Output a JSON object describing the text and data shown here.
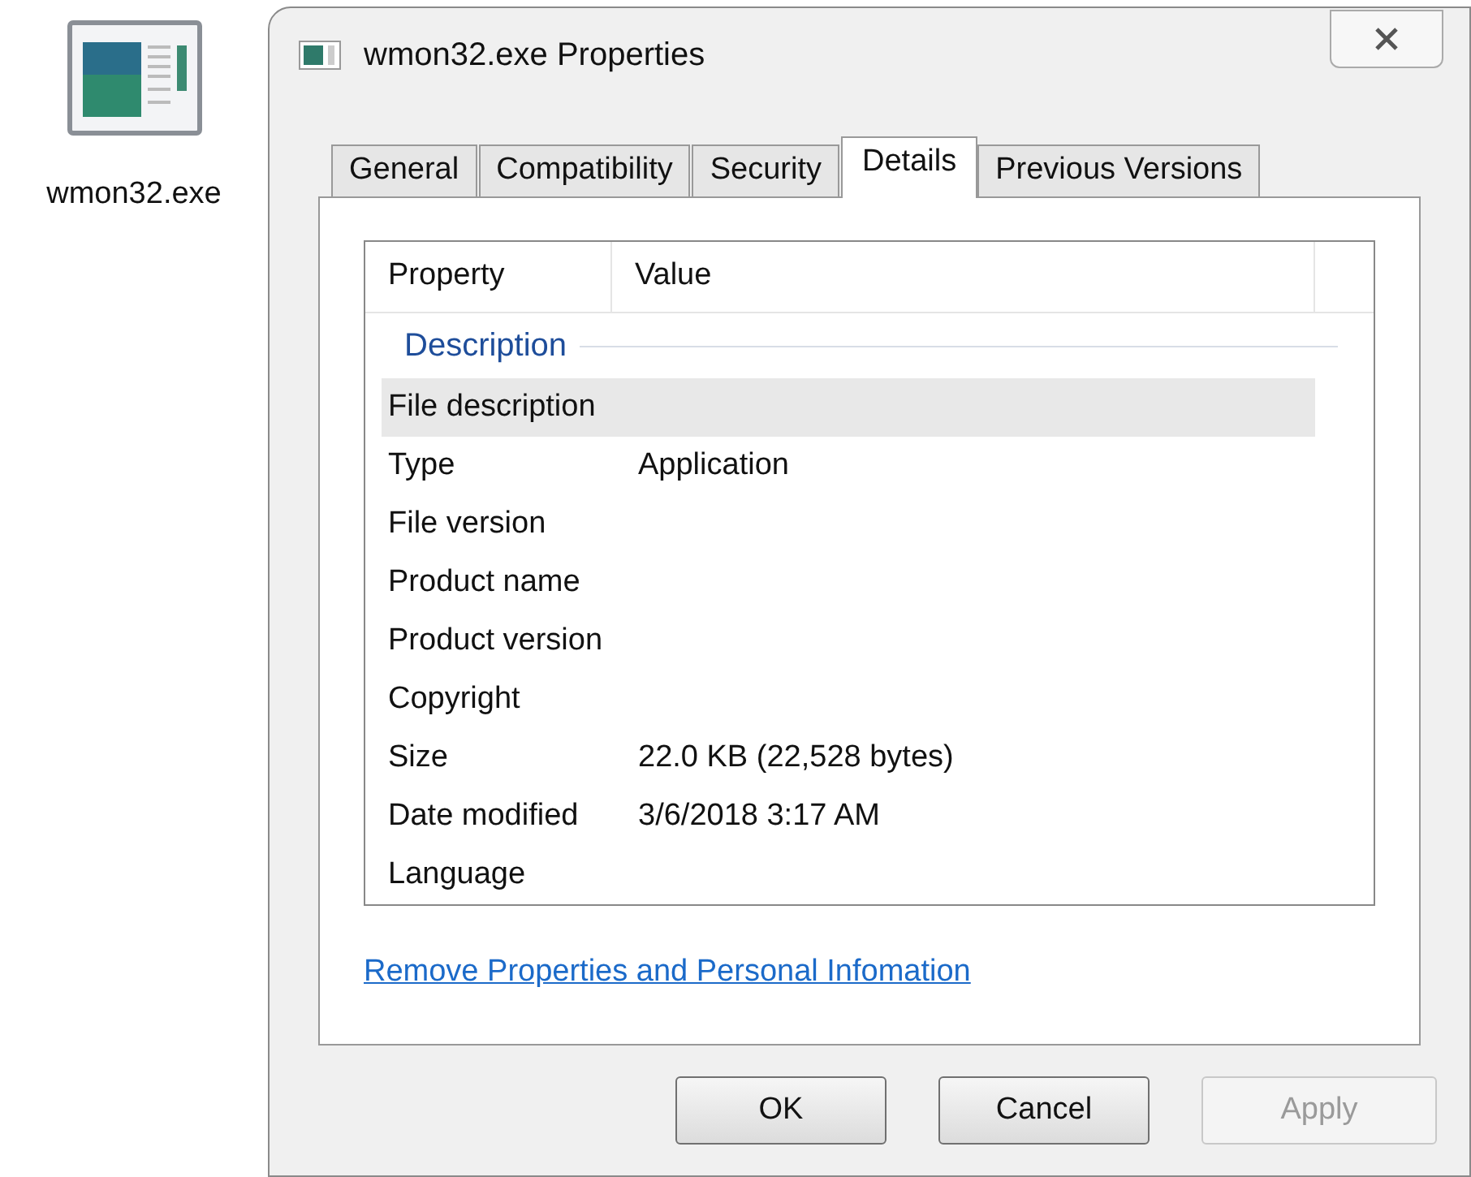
{
  "desktop_icon": {
    "label": "wmon32.exe"
  },
  "window": {
    "title": "wmon32.exe Properties"
  },
  "tabs": [
    {
      "label": "General",
      "selected": false
    },
    {
      "label": "Compatibility",
      "selected": false
    },
    {
      "label": "Security",
      "selected": false
    },
    {
      "label": "Details",
      "selected": true
    },
    {
      "label": "Previous Versions",
      "selected": false
    }
  ],
  "table": {
    "columns": [
      "Property",
      "Value"
    ],
    "rows": [
      {
        "kind": "group",
        "label": "Description"
      },
      {
        "kind": "item",
        "property": "File description",
        "value": "",
        "selected": true
      },
      {
        "kind": "item",
        "property": "Type",
        "value": "Application",
        "selected": false
      },
      {
        "kind": "item",
        "property": "File version",
        "value": "",
        "selected": false
      },
      {
        "kind": "item",
        "property": "Product name",
        "value": "",
        "selected": false
      },
      {
        "kind": "item",
        "property": "Product version",
        "value": "",
        "selected": false
      },
      {
        "kind": "item",
        "property": "Copyright",
        "value": "",
        "selected": false
      },
      {
        "kind": "item",
        "property": "Size",
        "value": "22.0 KB (22,528 bytes)",
        "selected": false
      },
      {
        "kind": "item",
        "property": "Date modified",
        "value": "3/6/2018 3:17 AM",
        "selected": false
      },
      {
        "kind": "item",
        "property": "Language",
        "value": "",
        "selected": false
      }
    ]
  },
  "link": "Remove Properties and Personal Infomation",
  "buttons": [
    {
      "label": "OK",
      "disabled": false
    },
    {
      "label": "Cancel",
      "disabled": false
    },
    {
      "label": "Apply",
      "disabled": true
    }
  ]
}
